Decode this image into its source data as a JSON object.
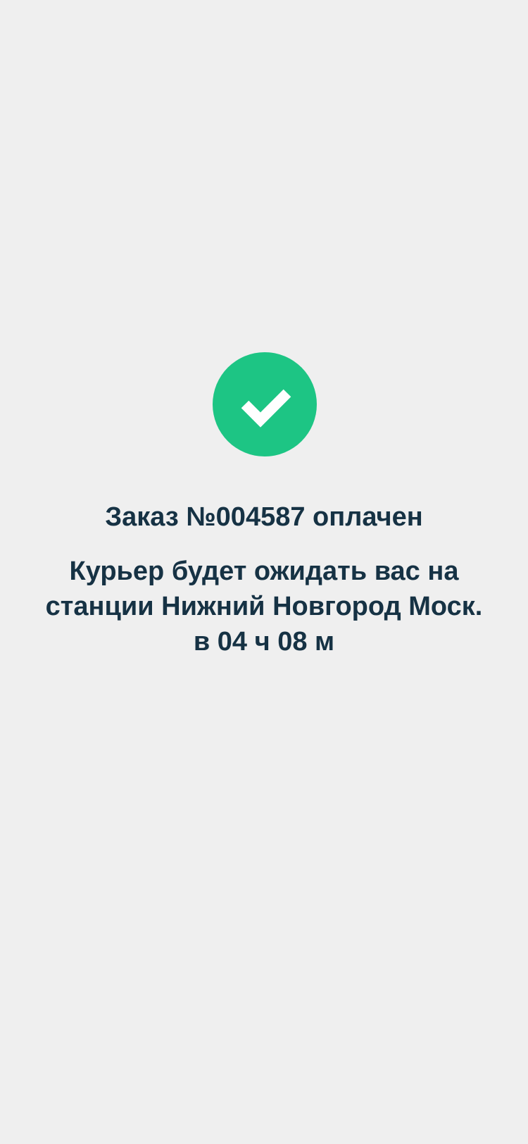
{
  "order": {
    "title": "Заказ №004587 оплачен",
    "message": "Курьер будет ожидать вас на станции  Нижний Новгород Моск. в 04 ч 08 м"
  },
  "icons": {
    "status": "checkmark-circle-icon"
  },
  "colors": {
    "background": "#efefef",
    "accent": "#1dc584",
    "text": "#163244"
  }
}
